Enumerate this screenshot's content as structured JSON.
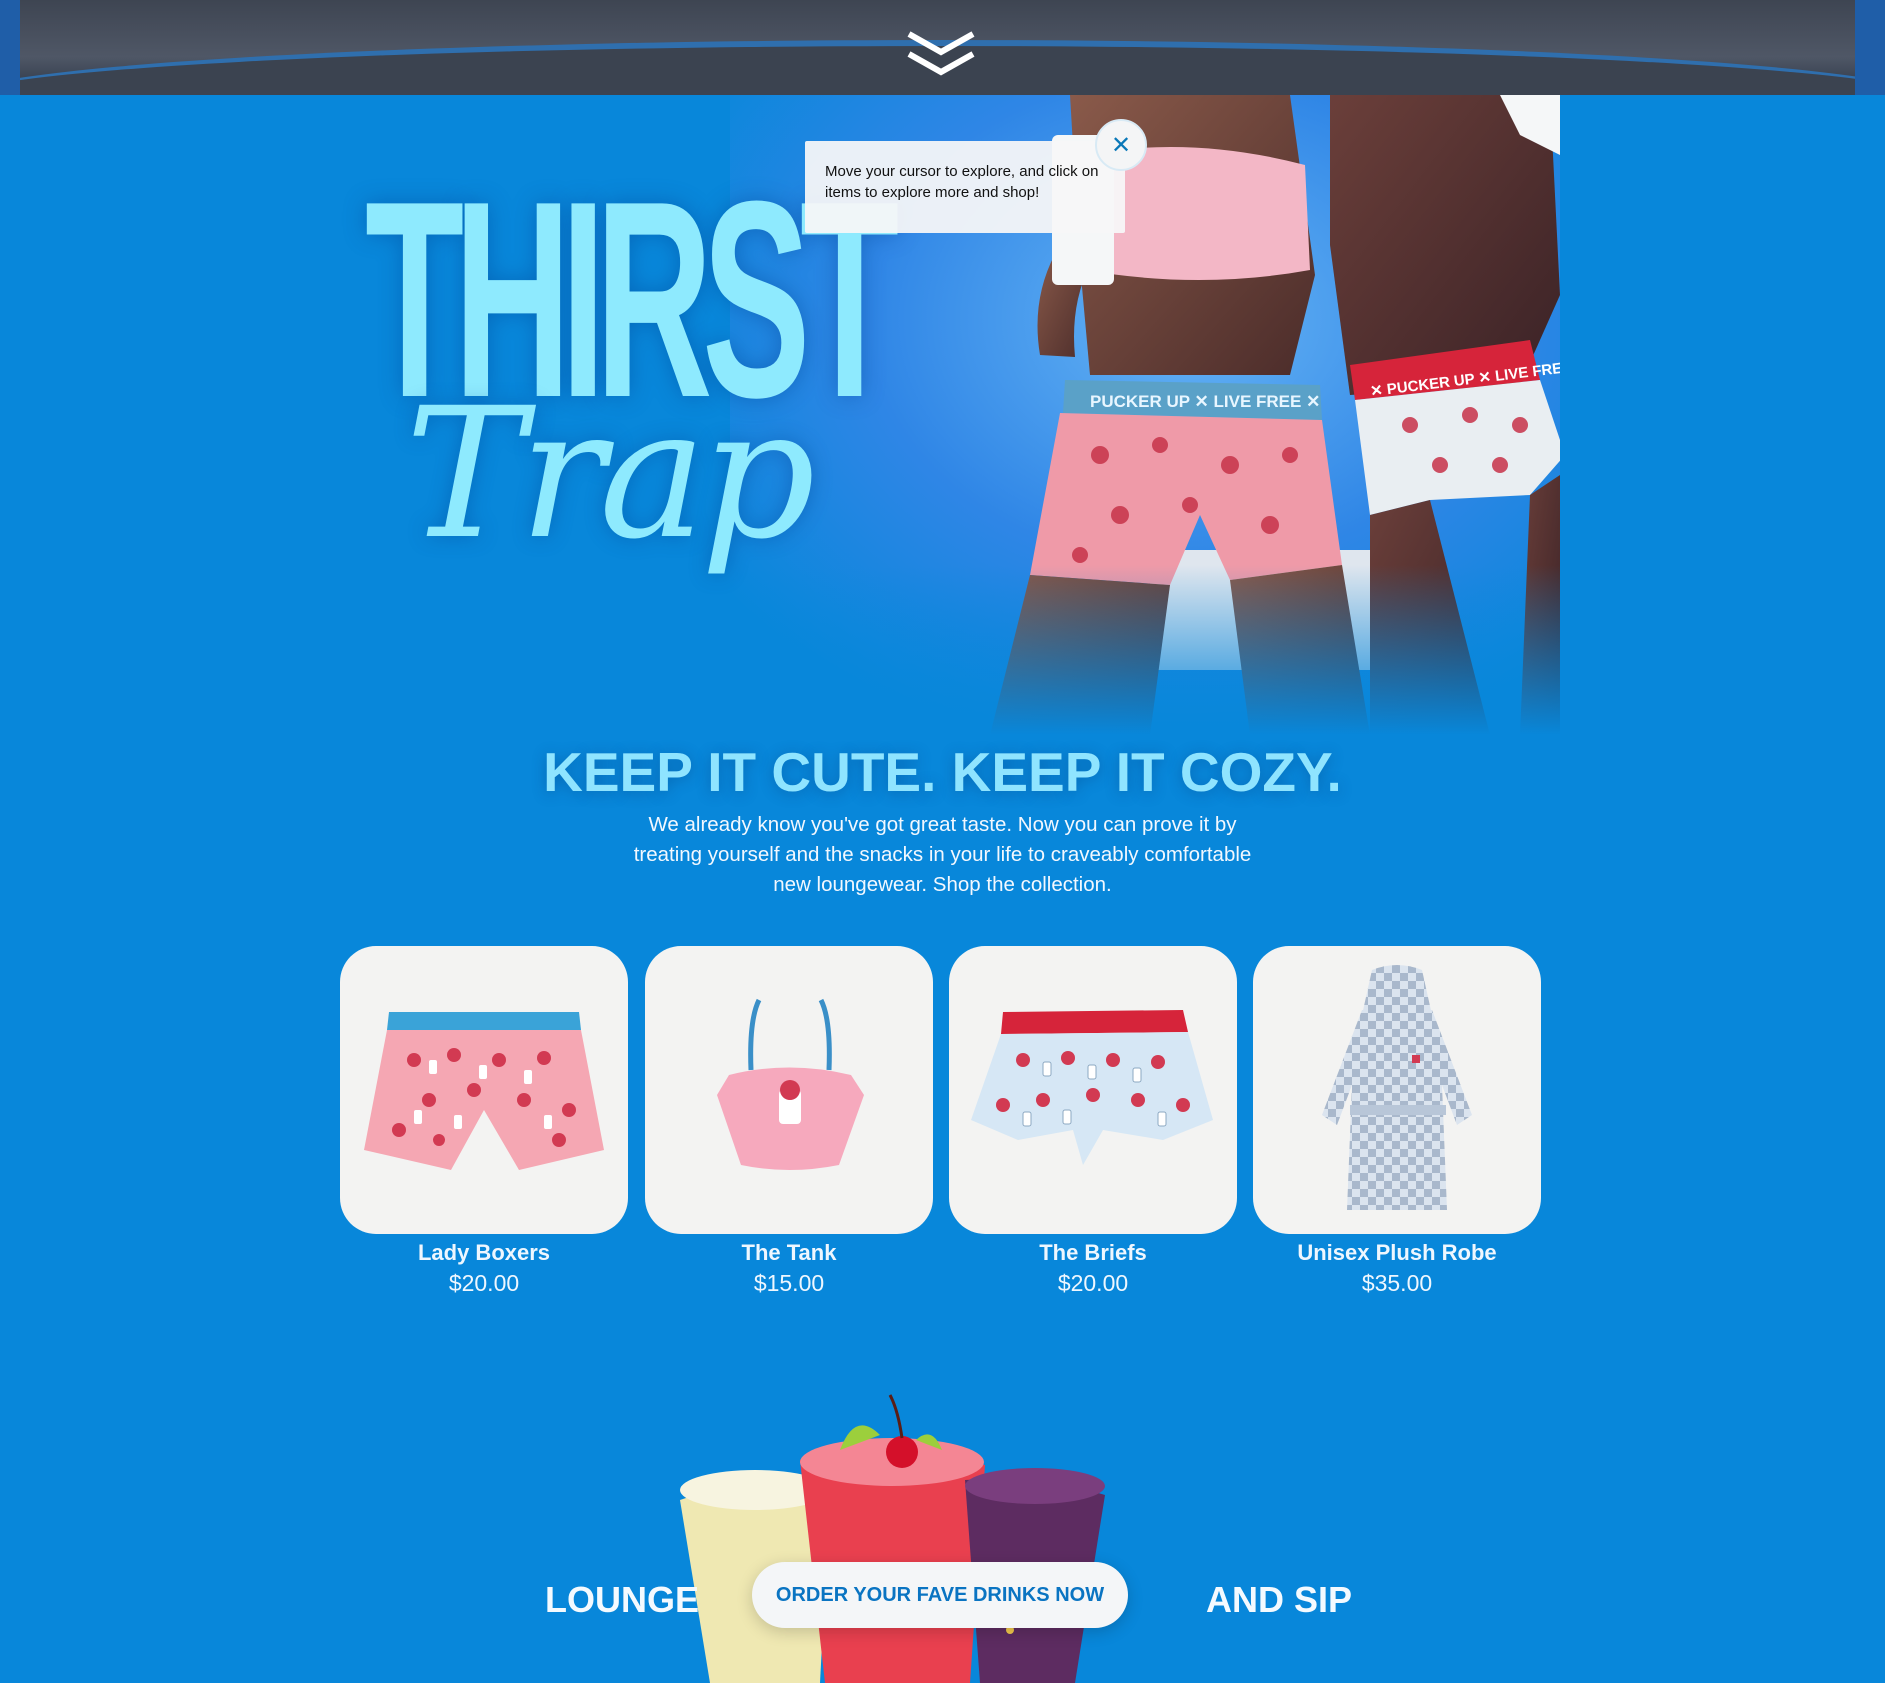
{
  "hero": {
    "title_top": "THIRST",
    "title_bottom": "Trap",
    "tooltip_text": "Move your cursor to explore, and click on items to explore more and shop!",
    "tooltip_close_glyph": "✕",
    "waistband_left": "PUCKER UP ✕ LIVE FREE ✕",
    "waistband_right": "✕ PUCKER UP ✕ LIVE FREE"
  },
  "intro": {
    "headline": "KEEP IT CUTE. KEEP IT COZY.",
    "body": "We already know you've got great taste. Now you can prove it by treating yourself and the snacks in your life to craveably comfortable new loungewear. Shop the collection."
  },
  "products": [
    {
      "name": "Lady Boxers",
      "price": "$20.00",
      "icon": "lady-boxers-image"
    },
    {
      "name": "The Tank",
      "price": "$15.00",
      "icon": "tank-top-image"
    },
    {
      "name": "The Briefs",
      "price": "$20.00",
      "icon": "briefs-image"
    },
    {
      "name": "Unisex Plush Robe",
      "price": "$35.00",
      "icon": "robe-image"
    }
  ],
  "cta": {
    "left_text": "LOUNGE",
    "button_label": "ORDER YOUR FAVE DRINKS NOW",
    "right_text": "AND SIP"
  },
  "colors": {
    "background": "#0887da",
    "title_cyan": "#8eeafe",
    "headline_cyan": "#8fe4ff",
    "card_bg": "#f3f3f2",
    "button_text": "#0a74c2"
  }
}
